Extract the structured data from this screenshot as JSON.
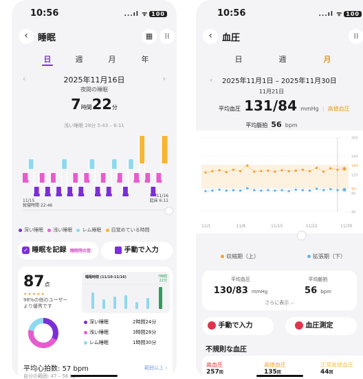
{
  "sleep": {
    "status": {
      "time": "10:56",
      "signal": "...ıl ᯤ",
      "battery": "100"
    },
    "header": {
      "title": "睡眠"
    },
    "tabs": [
      "日",
      "週",
      "月",
      "年"
    ],
    "date": "2025年11月16日",
    "subtitle": "夜間の睡眠",
    "duration": {
      "hours": "7",
      "hours_unit": "時間",
      "minutes": "22",
      "minutes_unit": "分"
    },
    "light_sleep_note": "浅い睡眠 28分 5:43 – 6:11",
    "chart": {
      "start_date": "11/15",
      "start_label": "就寝時間 22:46",
      "end_date": "11/16",
      "end_label": "起床 6:11"
    },
    "legend": [
      "深い睡眠",
      "浅い睡眠",
      "レム睡眠",
      "目覚めている時間"
    ],
    "buttons": {
      "record": "睡眠を記録",
      "record_badge": "睡眠時の音",
      "manual": "手動で入力"
    },
    "score": {
      "value": "87",
      "unit": "点",
      "stars": "★★★★★",
      "note1": "98%の他のユーザー",
      "note2": "より優秀です"
    },
    "mini_chart": {
      "title": "睡眠時間 (11/10-11/16)",
      "last_label": "7時間",
      "last_label2": "22分"
    },
    "breakdown": [
      {
        "label": "深い睡眠",
        "value": "2時間24分"
      },
      {
        "label": "浅い睡眠",
        "value": "3時間28分"
      },
      {
        "label": "レム睡眠",
        "value": "1時間30分"
      }
    ],
    "heart_rate": {
      "label": "平均心拍数:",
      "value": "57 bpm",
      "range_label": "自分の範囲:",
      "range": "47 – 56 bpm",
      "badge": "範囲以上"
    },
    "colors": {
      "deep": "#7b2fd6",
      "light": "#e65ccf",
      "rem": "#8fd8ee",
      "awake": "#f7b530"
    }
  },
  "bp": {
    "status": {
      "time": "10:56",
      "signal": "...ıl ᯤ",
      "battery": "100"
    },
    "header": {
      "title": "血圧"
    },
    "tabs": [
      "日",
      "週",
      "月"
    ],
    "date_range": "2025年11月1日 – 2025年11月30日",
    "selected_date": "11月21日",
    "avg_label": "平均血圧",
    "avg_value": "131/84",
    "avg_unit": "mmHg",
    "avg_status": "高値血圧",
    "pulse_label": "平均脈拍",
    "pulse_value": "56",
    "pulse_unit": "bpm",
    "chart_data": {
      "type": "scatter",
      "x_labels": [
        "11/1",
        "11/8",
        "11/15",
        "11/22",
        "11/30"
      ],
      "y_ticks": [
        200,
        160,
        140,
        120,
        90,
        80,
        40
      ],
      "ylim": [
        40,
        200
      ],
      "series": [
        {
          "name": "収縮期（上）",
          "color": "#f0a43a",
          "values": [
            124,
            127,
            129,
            125,
            130,
            127,
            139,
            126,
            127,
            128,
            126,
            129,
            127,
            128,
            130,
            127,
            134,
            126,
            133,
            130,
            132
          ]
        },
        {
          "name": "拡張期（下）",
          "color": "#6ab4e8",
          "values": [
            84,
            85,
            87,
            85,
            86,
            85,
            90,
            86,
            85,
            86,
            85,
            86,
            84,
            87,
            86,
            85,
            89,
            86,
            88,
            86,
            87
          ]
        }
      ]
    },
    "legend": [
      "収縮期（上）",
      "拡張期（下）"
    ],
    "summary": {
      "bp_label": "平均血圧",
      "bp_value": "130/83",
      "bp_unit": "mmHg",
      "pulse_label": "平均脈拍",
      "pulse_value": "56",
      "pulse_unit": "bpm",
      "more": "さらに表示 ⌵"
    },
    "buttons": {
      "manual": "手動で入力",
      "measure": "血圧測定"
    },
    "irregular_title": "不規則な血圧",
    "irregular": [
      {
        "label": "高血圧",
        "count": "257",
        "unit": "回",
        "color": "#e53935"
      },
      {
        "label": "高値血圧",
        "count": "135",
        "unit": "回",
        "color": "#f0a43a"
      },
      {
        "label": "正常高値血圧",
        "count": "44",
        "unit": "回",
        "color": "#f5c542"
      }
    ]
  }
}
